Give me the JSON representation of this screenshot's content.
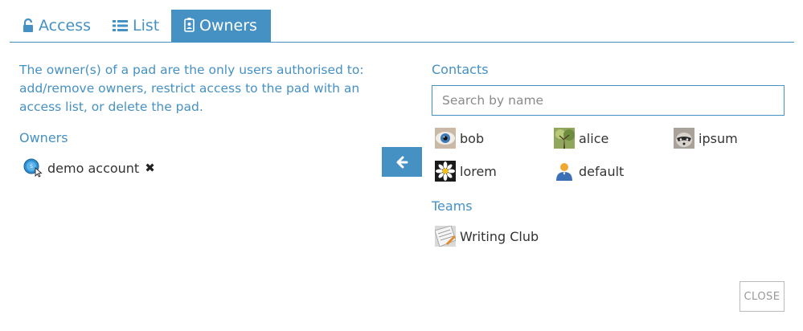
{
  "tabs": [
    {
      "label": "Access",
      "icon": "unlock-icon",
      "active": false
    },
    {
      "label": "List",
      "icon": "list-icon",
      "active": false
    },
    {
      "label": "Owners",
      "icon": "id-badge-icon",
      "active": true
    }
  ],
  "info_text": "The owner(s) of a pad are the only users authorised to: add/remove owners, restrict access to the pad with an access list, or delete the pad.",
  "owners": {
    "title": "Owners",
    "items": [
      {
        "name": "demo account",
        "avatar": "demo-account-avatar",
        "remove_icon": "remove-icon",
        "remove_glyph": "✖"
      }
    ]
  },
  "move_button": {
    "icon": "arrow-left-icon"
  },
  "contacts": {
    "title": "Contacts",
    "search_placeholder": "Search by name",
    "items": [
      {
        "name": "bob",
        "avatar": "eye-avatar"
      },
      {
        "name": "alice",
        "avatar": "tree-avatar"
      },
      {
        "name": "ipsum",
        "avatar": "raccoon-avatar"
      },
      {
        "name": "lorem",
        "avatar": "daisy-avatar"
      },
      {
        "name": "default",
        "avatar": "default-user-avatar"
      }
    ]
  },
  "teams": {
    "title": "Teams",
    "items": [
      {
        "name": "Writing Club",
        "avatar": "team-avatar"
      }
    ]
  },
  "close_label": "CLOSE",
  "colors": {
    "accent": "#4591c4",
    "text": "#333333",
    "muted": "#999999"
  }
}
